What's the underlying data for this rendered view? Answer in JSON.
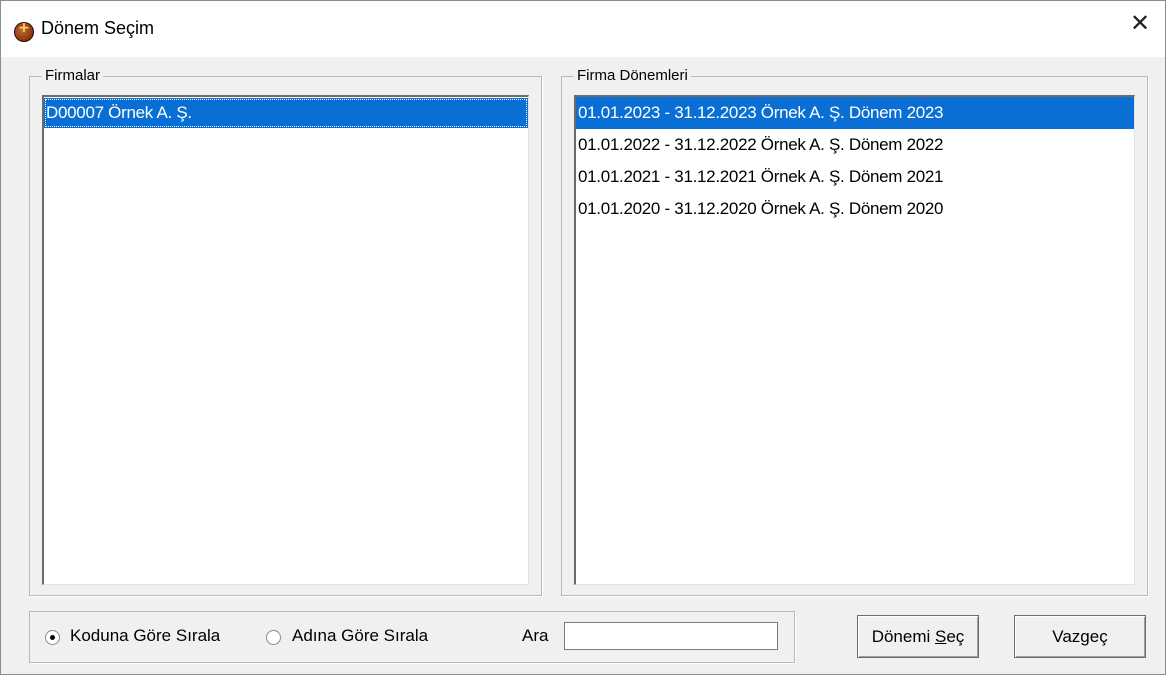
{
  "window": {
    "title": "Dönem Seçim",
    "close_glyph": "✕",
    "icon": "app-logo-icon"
  },
  "firmalar": {
    "legend": "Firmalar",
    "items": [
      {
        "label": "D00007 Örnek A. Ş.",
        "selected": true
      }
    ]
  },
  "donemler": {
    "legend": "Firma Dönemleri",
    "items": [
      {
        "label": "01.01.2023 - 31.12.2023  Örnek A. Ş. Dönem 2023",
        "selected": true
      },
      {
        "label": "01.01.2022 - 31.12.2022  Örnek A. Ş. Dönem 2022",
        "selected": false
      },
      {
        "label": "01.01.2021 - 31.12.2021  Örnek A. Ş. Dönem 2021",
        "selected": false
      },
      {
        "label": "01.01.2020 - 31.12.2020  Örnek A. Ş. Dönem 2020",
        "selected": false
      }
    ]
  },
  "sort": {
    "by_code_label": "Koduna Göre Sırala",
    "by_name_label": "Adına Göre Sırala",
    "selected": "by_code"
  },
  "search": {
    "label": "Ara",
    "value": ""
  },
  "buttons": {
    "select_prefix": "Dönemi ",
    "select_underlined": "S",
    "select_suffix": "eç",
    "cancel_label": "Vazgeç"
  },
  "colors": {
    "selection": "#0a6fd4",
    "face": "#f0f0f0"
  }
}
